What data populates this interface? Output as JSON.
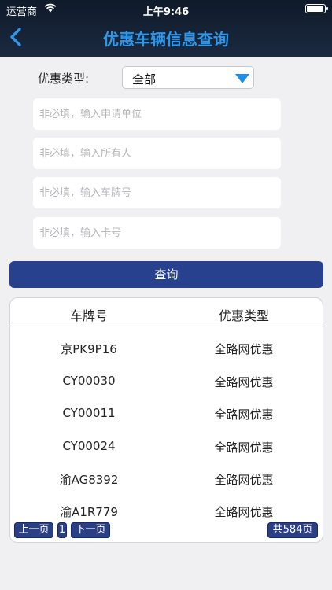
{
  "status_bar": {
    "carrier": "运营商",
    "time": "上午9:46",
    "battery_level": 0.95
  },
  "nav": {
    "title": "优惠车辆信息查询"
  },
  "form": {
    "discount_type_label": "优惠类型:",
    "discount_type_value": "全部",
    "fields": [
      {
        "placeholder": "非必填，输入申请单位"
      },
      {
        "placeholder": "非必填，输入所有人"
      },
      {
        "placeholder": "非必填，输入车牌号"
      },
      {
        "placeholder": "非必填，输入卡号"
      }
    ],
    "query_label": "查询"
  },
  "table": {
    "headers": [
      "车牌号",
      "优惠类型"
    ],
    "rows": [
      [
        "京PK9P16",
        "全路网优惠"
      ],
      [
        "CY00030",
        "全路网优惠"
      ],
      [
        "CY00011",
        "全路网优惠"
      ],
      [
        "CY00024",
        "全路网优惠"
      ],
      [
        "渝AG8392",
        "全路网优惠"
      ],
      [
        "渝A1R779",
        "全路网优惠"
      ]
    ]
  },
  "pagination": {
    "prev_label": "上一页",
    "current_page": "1",
    "next_label": "下一页",
    "total_label": "共584页"
  },
  "colors": {
    "accent": "#2f97ea",
    "button": "#27418f",
    "page_button": "#2a3f84"
  }
}
